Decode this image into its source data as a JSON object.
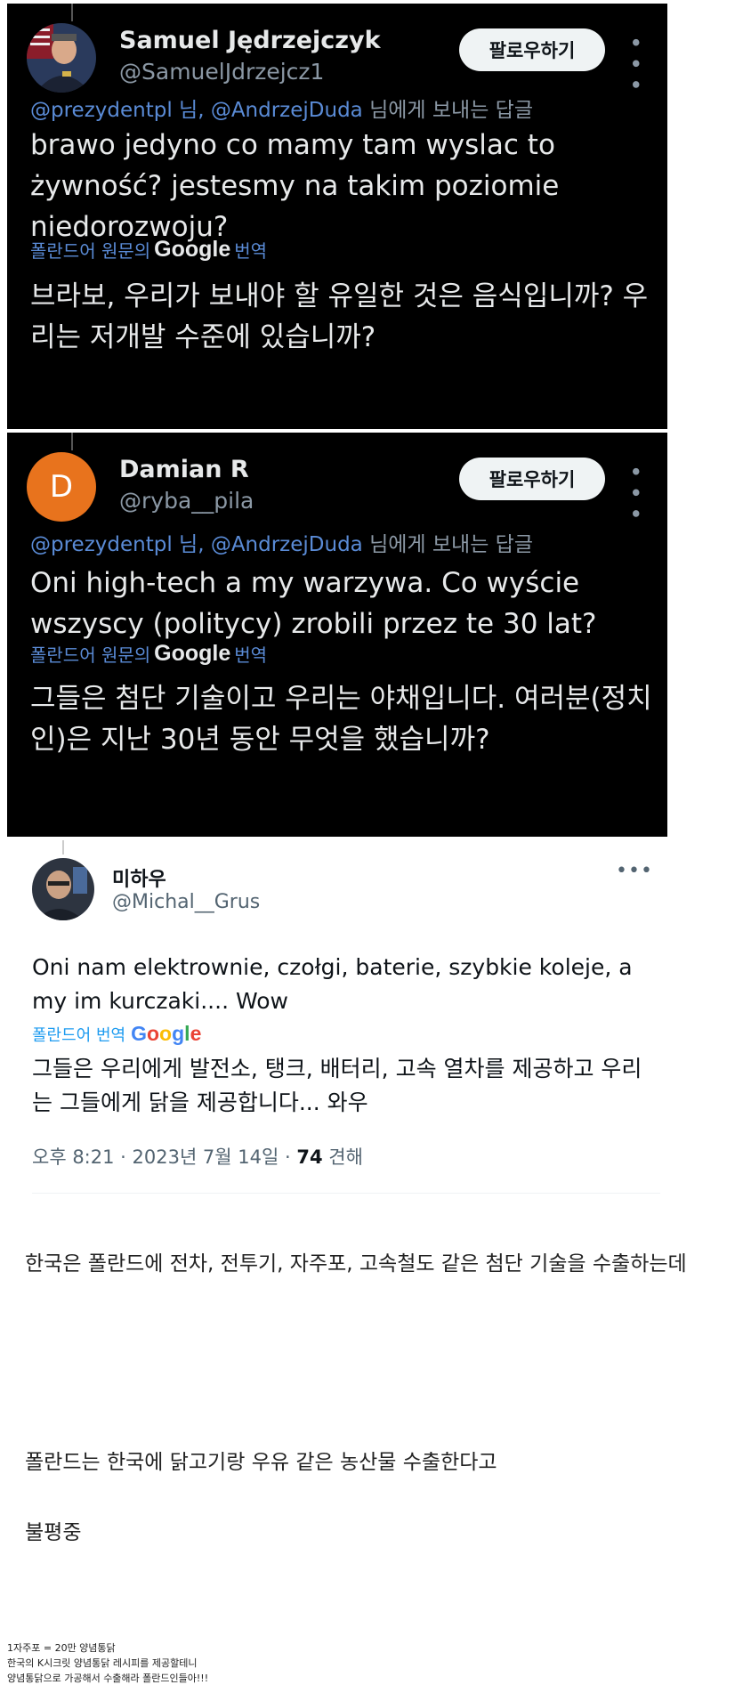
{
  "tweets": [
    {
      "name": "Samuel Jędrzejczyk",
      "handle": "@SamuelJdrzejcz1",
      "follow_label": "팔로우하기",
      "reply_prefix": "@prezydentpl 님, @AndrzejDuda",
      "reply_suffix": " 님에게 보내는 답글",
      "text": "brawo jedyno co mamy tam wyslac to żywność?  jestesmy na takim poziomie niedorozwoju?",
      "translate_label": "폴란드어 원문의",
      "translate_brand": "Google",
      "translate_action": "번역",
      "translation": "브라보, 우리가 보내야 할 유일한 것은 음식입니까? 우리는 저개발 수준에 있습니까?"
    },
    {
      "name": "Damian R",
      "handle": "@ryba__pila",
      "avatar_letter": "D",
      "follow_label": "팔로우하기",
      "reply_prefix": "@prezydentpl 님, @AndrzejDuda",
      "reply_suffix": " 님에게 보내는 답글",
      "text": "Oni high-tech a my warzywa. Co wyście wszyscy (politycy) zrobili przez te 30 lat?",
      "translate_label": "폴란드어 원문의",
      "translate_brand": "Google",
      "translate_action": "번역",
      "translation": "그들은 첨단 기술이고 우리는 야채입니다. 여러분(정치인)은 지난 30년 동안 무엇을 했습니까?"
    },
    {
      "name": "미하우",
      "handle": "@Michal__Grus",
      "text": "Oni nam elektrownie, czołgi, baterie, szybkie koleje, a my im kurczaki.... Wow",
      "translate_label": "폴란드어 번역",
      "translate_brand": "Google",
      "translation": "그들은 우리에게 발전소, 탱크, 배터리, 고속 열차를 제공하고 우리는 그들에게 닭을 제공합니다... 와우",
      "time": "오후 8:21 · 2023년 7월 14일 · ",
      "views_count": "74",
      "views_label": " 견해"
    }
  ],
  "post": {
    "line1": "한국은 폴란드에 전차, 전투기, 자주포, 고속철도 같은 첨단 기술을 수출하는데",
    "line2": "폴란드는 한국에 닭고기랑 우유 같은 농산물 수출한다고",
    "line3": "불평중"
  },
  "footnote": {
    "line1": "1자주포 =  20만 양념통닭",
    "line2": "한국의 K시크릿 양념통닭 레시피를 제공할테니",
    "line3": "양념통닭으로 가공해서 수출해라 폴란드인들아!!!"
  },
  "colors": {
    "dark_bg": "#000000",
    "mention_blue": "#5a8bd6",
    "avatar_orange": "#e8731d"
  }
}
